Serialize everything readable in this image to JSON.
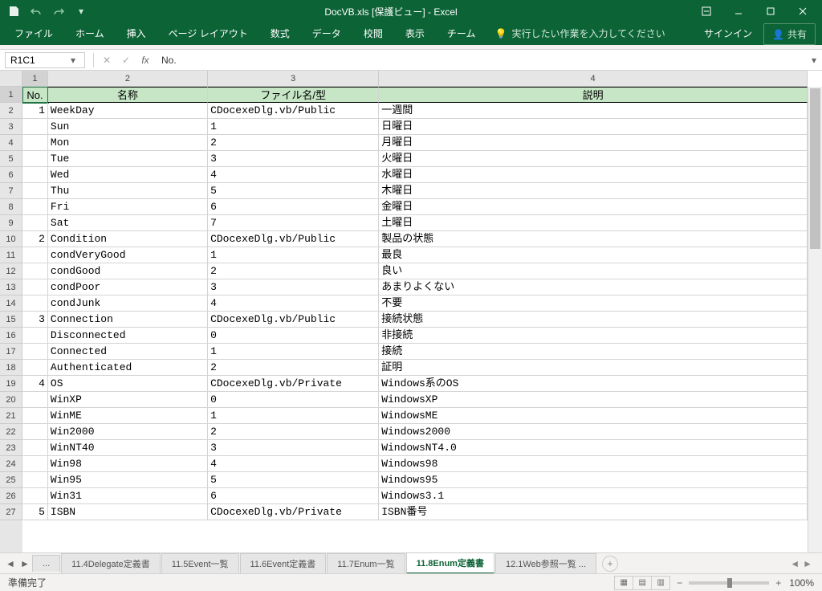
{
  "title": "DocVB.xls [保護ビュー] - Excel",
  "qat": {
    "save": "保存",
    "undo": "元に戻す",
    "redo": "やり直し"
  },
  "ribbon": {
    "file": "ファイル",
    "home": "ホーム",
    "insert": "挿入",
    "page_layout": "ページ レイアウト",
    "formulas": "数式",
    "data": "データ",
    "review": "校閲",
    "view": "表示",
    "team": "チーム",
    "tellme": "実行したい作業を入力してください",
    "signin": "サインイン",
    "share": "共有"
  },
  "name_box": "R1C1",
  "formula": "No.",
  "col_headers": [
    "1",
    "2",
    "3",
    "4"
  ],
  "row_numbers": [
    "1",
    "2",
    "3",
    "4",
    "5",
    "6",
    "7",
    "8",
    "9",
    "10",
    "11",
    "12",
    "13",
    "14",
    "15",
    "16",
    "17",
    "18",
    "19",
    "20",
    "21",
    "22",
    "23",
    "24",
    "25",
    "26",
    "27"
  ],
  "headers": {
    "no": "No.",
    "name": "名称",
    "file": "ファイル名/型",
    "desc": "説明"
  },
  "rows": [
    {
      "no": "1",
      "name": "WeekDay",
      "file": "CDocexeDlg.vb/Public",
      "desc": "一週間"
    },
    {
      "no": "",
      "name": "Sun",
      "file": "1",
      "desc": "日曜日"
    },
    {
      "no": "",
      "name": "Mon",
      "file": "2",
      "desc": "月曜日"
    },
    {
      "no": "",
      "name": "Tue",
      "file": "3",
      "desc": "火曜日"
    },
    {
      "no": "",
      "name": "Wed",
      "file": "4",
      "desc": "水曜日"
    },
    {
      "no": "",
      "name": "Thu",
      "file": "5",
      "desc": "木曜日"
    },
    {
      "no": "",
      "name": "Fri",
      "file": "6",
      "desc": "金曜日"
    },
    {
      "no": "",
      "name": "Sat",
      "file": "7",
      "desc": "土曜日"
    },
    {
      "no": "2",
      "name": "Condition",
      "file": "CDocexeDlg.vb/Public",
      "desc": "製品の状態"
    },
    {
      "no": "",
      "name": "condVeryGood",
      "file": "1",
      "desc": "最良"
    },
    {
      "no": "",
      "name": "condGood",
      "file": "2",
      "desc": "良い"
    },
    {
      "no": "",
      "name": "condPoor",
      "file": "3",
      "desc": "あまりよくない"
    },
    {
      "no": "",
      "name": "condJunk",
      "file": "4",
      "desc": "不要"
    },
    {
      "no": "3",
      "name": "Connection",
      "file": "CDocexeDlg.vb/Public",
      "desc": "接続状態"
    },
    {
      "no": "",
      "name": "Disconnected",
      "file": "0",
      "desc": "非接続"
    },
    {
      "no": "",
      "name": "Connected",
      "file": "1",
      "desc": "接続"
    },
    {
      "no": "",
      "name": "Authenticated",
      "file": "2",
      "desc": "証明"
    },
    {
      "no": "4",
      "name": "OS",
      "file": "CDocexeDlg.vb/Private",
      "desc": "Windows系のOS"
    },
    {
      "no": "",
      "name": "WinXP",
      "file": "0",
      "desc": "WindowsXP"
    },
    {
      "no": "",
      "name": "WinME",
      "file": "1",
      "desc": "WindowsME"
    },
    {
      "no": "",
      "name": "Win2000",
      "file": "2",
      "desc": "Windows2000"
    },
    {
      "no": "",
      "name": "WinNT40",
      "file": "3",
      "desc": "WindowsNT4.0"
    },
    {
      "no": "",
      "name": "Win98",
      "file": "4",
      "desc": "Windows98"
    },
    {
      "no": "",
      "name": "Win95",
      "file": "5",
      "desc": "Windows95"
    },
    {
      "no": "",
      "name": "Win31",
      "file": "6",
      "desc": "Windows3.1"
    },
    {
      "no": "5",
      "name": "ISBN",
      "file": "CDocexeDlg.vb/Private",
      "desc": "ISBN番号"
    }
  ],
  "sheets": {
    "more": "...",
    "s1": "11.4Delegate定義書",
    "s2": "11.5Event一覧",
    "s3": "11.6Event定義書",
    "s4": "11.7Enum一覧",
    "s5": "11.8Enum定義書",
    "s6": "12.1Web参照一覧 ..."
  },
  "status": {
    "ready": "準備完了",
    "zoom": "100%"
  }
}
